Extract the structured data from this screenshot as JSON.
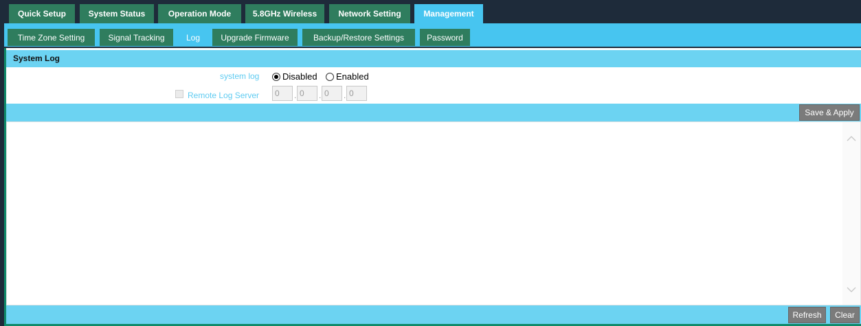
{
  "top_tabs": [
    {
      "label": "Quick Setup"
    },
    {
      "label": "System Status"
    },
    {
      "label": "Operation Mode"
    },
    {
      "label": "5.8GHz Wireless"
    },
    {
      "label": "Network Setting"
    },
    {
      "label": "Management"
    }
  ],
  "sub_tabs": [
    {
      "label": "Time Zone Setting"
    },
    {
      "label": "Signal Tracking"
    },
    {
      "label": "Log"
    },
    {
      "label": "Upgrade Firmware"
    },
    {
      "label": "Backup/Restore Settings"
    },
    {
      "label": "Password"
    }
  ],
  "section": {
    "title": "System Log"
  },
  "form": {
    "system_log_label": "system log",
    "disabled_label": "Disabled",
    "enabled_label": "Enabled",
    "selected": "Disabled",
    "remote_label": "Remote Log Server",
    "ip": [
      "0",
      "0",
      "0",
      "0"
    ]
  },
  "buttons": {
    "save_apply": "Save & Apply",
    "refresh": "Refresh",
    "clear": "Clear"
  },
  "log": {
    "text": ""
  },
  "colors": {
    "tab_bg": "#2f7d5e",
    "accent": "#47c5f0",
    "bar": "#6cd3f2",
    "label_text": "#5ecbf1"
  }
}
